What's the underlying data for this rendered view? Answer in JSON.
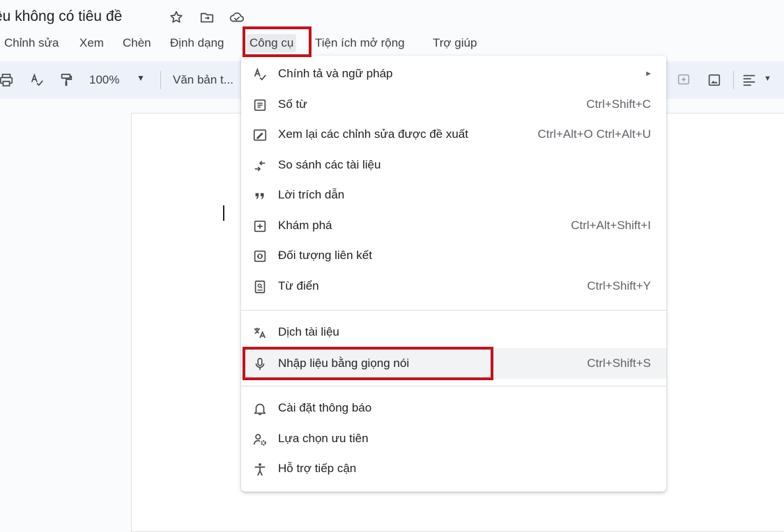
{
  "document": {
    "title": "ệu không có tiêu đề",
    "zoom": "100%",
    "paragraph_style": "Văn bản t..."
  },
  "title_icons": [
    "star-icon",
    "move-to-folder-icon",
    "cloud-status-icon"
  ],
  "menu_bar": {
    "items": [
      {
        "label": "Chỉnh sửa"
      },
      {
        "label": "Xem"
      },
      {
        "label": "Chèn"
      },
      {
        "label": "Định dạng"
      },
      {
        "label": "Công cụ"
      },
      {
        "label": "Tiện ích mở rộng"
      },
      {
        "label": "Trợ giúp"
      }
    ]
  },
  "tools_menu": {
    "items": [
      {
        "label": "Chính tả và ngữ pháp",
        "shortcut": "",
        "icon": "spellcheck-icon",
        "submenu": true
      },
      {
        "label": "Số từ",
        "shortcut": "Ctrl+Shift+C",
        "icon": "word-count-icon"
      },
      {
        "label": "Xem lại các chỉnh sửa được đề xuất",
        "shortcut": "Ctrl+Alt+O Ctrl+Alt+U",
        "icon": "review-edits-icon"
      },
      {
        "label": "So sánh các tài liệu",
        "shortcut": "",
        "icon": "compare-documents-icon"
      },
      {
        "label": "Lời trích dẫn",
        "shortcut": "",
        "icon": "citations-icon"
      },
      {
        "label": "Khám phá",
        "shortcut": "Ctrl+Alt+Shift+I",
        "icon": "explore-icon"
      },
      {
        "label": "Đối tượng liên kết",
        "shortcut": "",
        "icon": "linked-objects-icon"
      },
      {
        "label": "Từ điển",
        "shortcut": "Ctrl+Shift+Y",
        "icon": "dictionary-icon"
      },
      {
        "label": "Dịch tài liệu",
        "shortcut": "",
        "icon": "translate-icon"
      },
      {
        "label": "Nhập liệu bằng giọng nói",
        "shortcut": "Ctrl+Shift+S",
        "icon": "microphone-icon"
      },
      {
        "label": "Cài đặt thông báo",
        "shortcut": "",
        "icon": "bell-icon"
      },
      {
        "label": "Lựa chọn ưu tiên",
        "shortcut": "",
        "icon": "preferences-icon"
      },
      {
        "label": "Hỗ trợ tiếp cận",
        "shortcut": "",
        "icon": "accessibility-icon"
      }
    ]
  },
  "colors": {
    "highlight_box": "#c5121b",
    "toolbar_bg": "#edf2fa",
    "menu_hover": "#f1f3f4"
  }
}
